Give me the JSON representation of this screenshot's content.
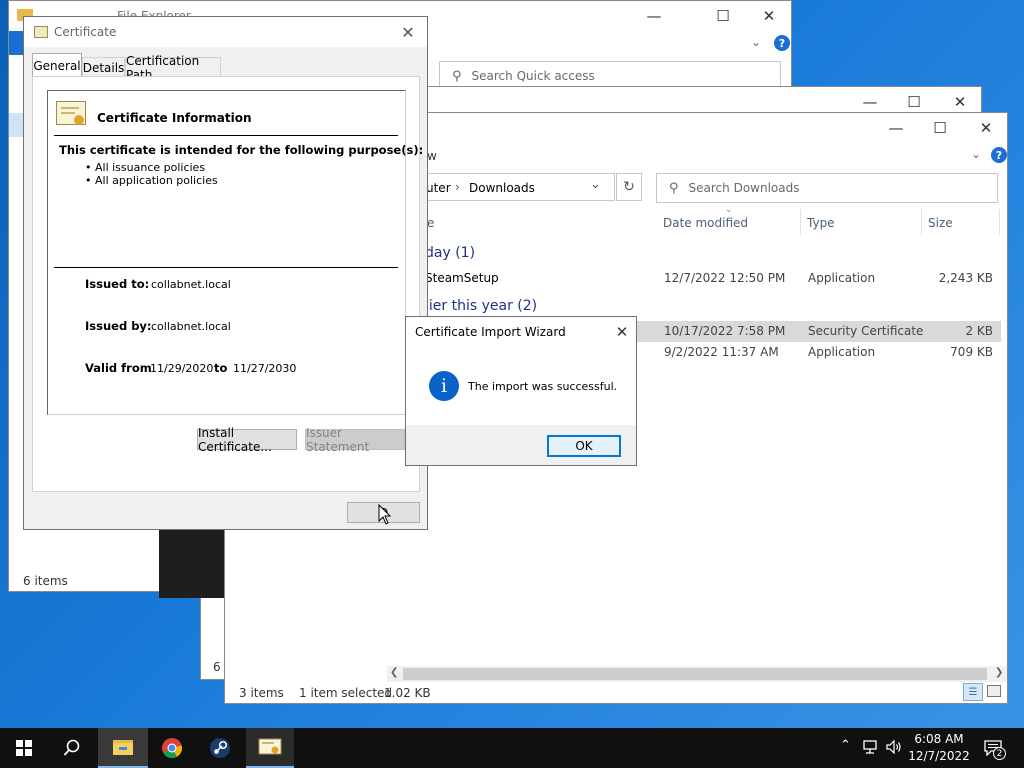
{
  "explorer1": {
    "title": "File Explorer",
    "search_placeholder": "Search Quick access",
    "status": "6 items"
  },
  "explorer2": {
    "status_partial": "6 i"
  },
  "explorer3": {
    "ribbon_partial": "w",
    "breadcrumb": {
      "part1": "uter",
      "sep": "›",
      "part2": "Downloads"
    },
    "search_placeholder": "Search Downloads",
    "columns": {
      "name": "e",
      "date": "Date modified",
      "type": "Type",
      "size": "Size"
    },
    "groups": [
      {
        "label": "day (1)"
      },
      {
        "label": "lier this year (2)"
      }
    ],
    "rows": [
      {
        "name": "SteamSetup",
        "date": "12/7/2022 12:50 PM",
        "type": "Application",
        "size": "2,243 KB"
      },
      {
        "name": "",
        "date": "10/17/2022 7:58 PM",
        "type": "Security Certificate",
        "size": "2 KB"
      },
      {
        "name": "",
        "date": "9/2/2022 11:37 AM",
        "type": "Application",
        "size": "709 KB"
      }
    ],
    "status_items": "3 items",
    "status_selected": "1 item selected",
    "status_size": "1.02 KB"
  },
  "certificate": {
    "title": "Certificate",
    "tabs": [
      "General",
      "Details",
      "Certification Path"
    ],
    "info_title": "Certificate Information",
    "purpose_heading": "This certificate is intended for the following purpose(s):",
    "purposes": [
      "• All issuance policies",
      "• All application policies"
    ],
    "issued_to_label": "Issued to:",
    "issued_to": "collabnet.local",
    "issued_by_label": "Issued by:",
    "issued_by": "collabnet.local",
    "valid_from_label": "Valid from",
    "valid_from": "11/29/2020",
    "to_label": "to",
    "valid_to": "11/27/2030",
    "install_btn": "Install Certificate...",
    "issuer_btn": "Issuer Statement",
    "ok_btn": "O"
  },
  "wizard": {
    "title": "Certificate Import Wizard",
    "message": "The import was successful.",
    "ok": "OK"
  },
  "taskbar": {
    "time": "6:08 AM",
    "date": "12/7/2022",
    "notif_count": "2"
  },
  "colors": {
    "accent": "#0078d7",
    "taskbar": "#101010",
    "selected_row": "#d9d9d9"
  }
}
